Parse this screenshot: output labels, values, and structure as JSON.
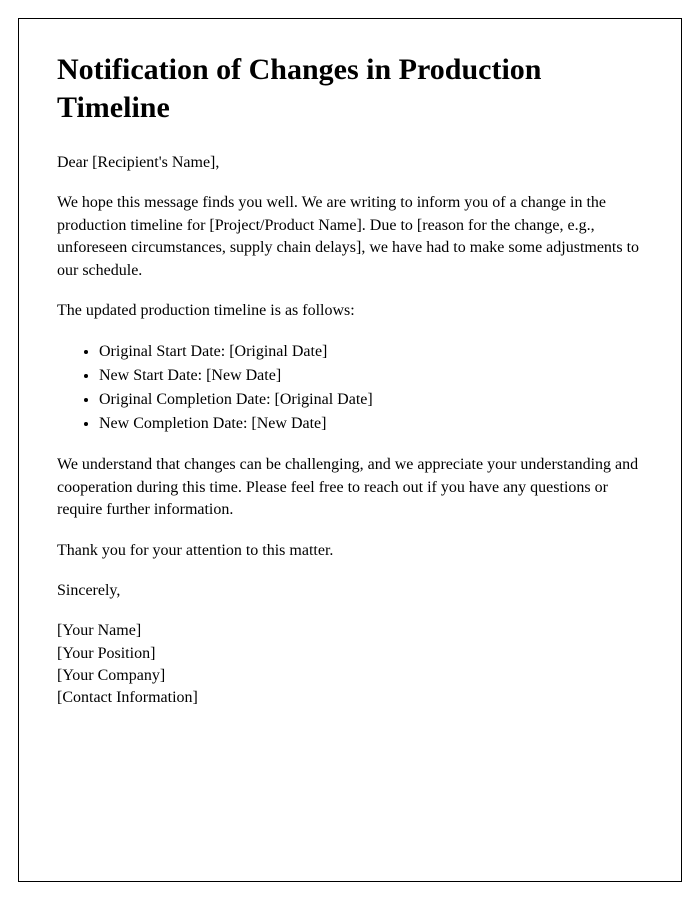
{
  "title": "Notification of Changes in Production Timeline",
  "salutation": "Dear [Recipient's Name],",
  "intro_paragraph": "We hope this message finds you well. We are writing to inform you of a change in the production timeline for [Project/Product Name]. Due to [reason for the change, e.g., unforeseen circumstances, supply chain delays], we have had to make some adjustments to our schedule.",
  "timeline_intro": "The updated production timeline is as follows:",
  "timeline_items": [
    "Original Start Date: [Original Date]",
    "New Start Date: [New Date]",
    "Original Completion Date: [Original Date]",
    "New Completion Date: [New Date]"
  ],
  "understanding_paragraph": "We understand that changes can be challenging, and we appreciate your understanding and cooperation during this time. Please feel free to reach out if you have any questions or require further information.",
  "thank_you": "Thank you for your attention to this matter.",
  "closing": "Sincerely,",
  "signature": {
    "name": "[Your Name]",
    "position": "[Your Position]",
    "company": "[Your Company]",
    "contact": "[Contact Information]"
  }
}
